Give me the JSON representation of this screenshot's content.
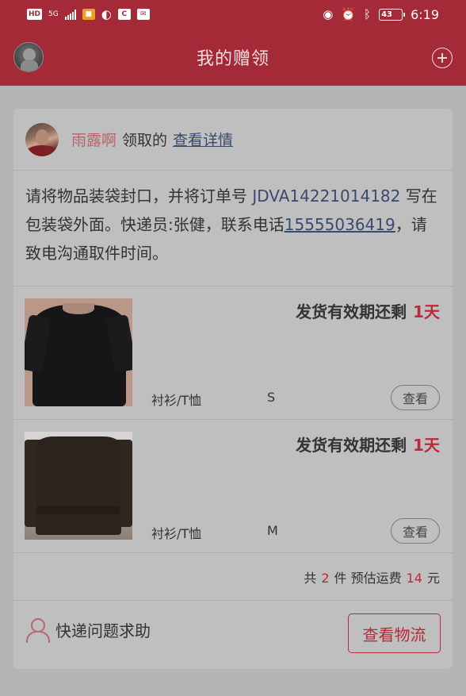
{
  "status_bar": {
    "left_badges": [
      "HD",
      "5G"
    ],
    "battery": "43",
    "time": "6:19"
  },
  "header": {
    "title": "我的赠领"
  },
  "card": {
    "donor_name": "雨露啊",
    "claim_text": "领取的",
    "detail_link": "查看详情",
    "instructions": {
      "part1": "请将物品装袋封口，并将订单号 ",
      "order_no": "JDVA14221014182",
      "part2": " 写在包装袋外面。快递员:张健，联系电话",
      "phone": "15555036419",
      "part3": "，请致电沟通取件时间。"
    },
    "items": [
      {
        "validity_label": "发货有效期还剩",
        "validity_days": "1天",
        "category": "衬衫/T恤",
        "size": "S",
        "view_label": "查看"
      },
      {
        "validity_label": "发货有效期还剩",
        "validity_days": "1天",
        "category": "衬衫/T恤",
        "size": "M",
        "view_label": "查看"
      }
    ],
    "summary": {
      "prefix": "共",
      "count": "2",
      "mid": "件 预估运费",
      "fee": "14",
      "suffix": "元"
    },
    "help_label": "快递问题求助",
    "logistics_button": "查看物流"
  },
  "colors": {
    "brand": "#a52a37",
    "accent_red": "#b82a38",
    "link_blue": "#3a4a70"
  }
}
